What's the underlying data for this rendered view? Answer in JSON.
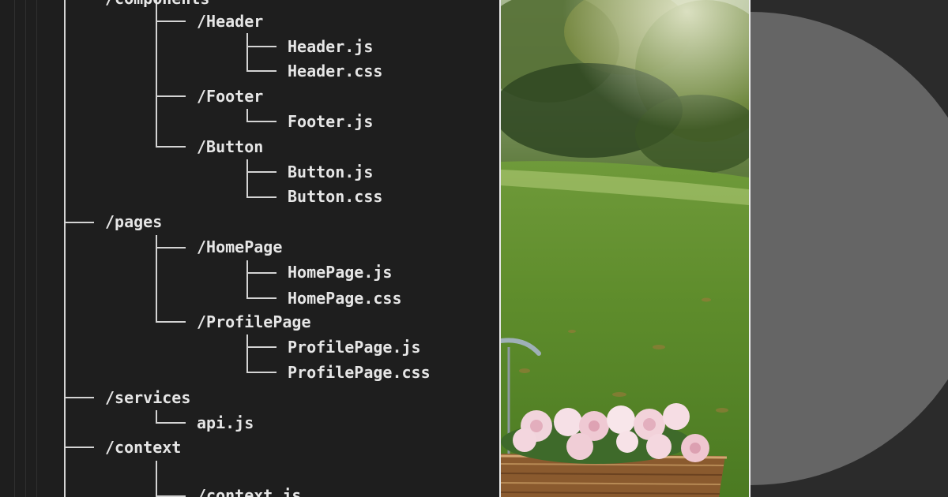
{
  "tree": {
    "components_label": "/components",
    "header_folder": "/Header",
    "header_js": "Header.js",
    "header_css": "Header.css",
    "footer_folder": "/Footer",
    "footer_js": "Footer.js",
    "button_folder": "/Button",
    "button_js": "Button.js",
    "button_css": "Button.css",
    "pages_folder": "/pages",
    "homepage_folder": "/HomePage",
    "homepage_js": "HomePage.js",
    "homepage_css": "HomePage.css",
    "profilepage_folder": "/ProfilePage",
    "profilepage_js": "ProfilePage.js",
    "profilepage_css": "ProfilePage.css",
    "services_folder": "/services",
    "api_js": "api.js",
    "context_folder": "/context",
    "context_js": "/context.js"
  },
  "photo": {
    "subject": "flower-basket-bicycle-on-grass"
  },
  "colors": {
    "editor_bg": "#1e1e1e",
    "text": "#e6e6e6",
    "tree_lines": "#d4d4d4",
    "panel_bg": "#2b2b2b",
    "disc": "#656565"
  }
}
